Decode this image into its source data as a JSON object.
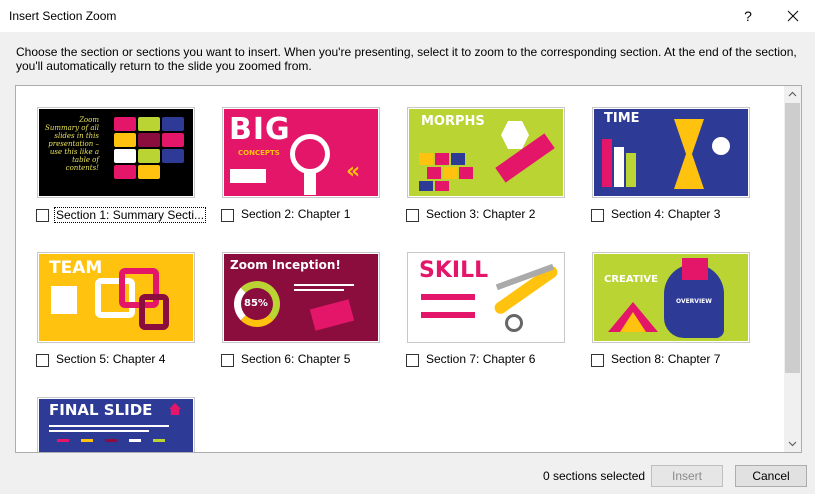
{
  "dialog": {
    "title": "Insert Section Zoom",
    "help_label": "?",
    "instructions": "Choose the section or sections you want to insert. When you're presenting, select it to zoom to the corresponding section. At the end of the section, you'll automatically return to the slide you zoomed from."
  },
  "sections": [
    {
      "label": "Section 1: Summary Secti...",
      "thumb_text": "Zoom Summary of all slides in this presentation – use this like a table of contents!",
      "bg": "#000000",
      "checked": false
    },
    {
      "label": "Section 2: Chapter 1",
      "thumb_text": "BIG",
      "thumb_sub": "CONCEPTS",
      "bg": "#e3166a",
      "checked": false
    },
    {
      "label": "Section 3: Chapter 2",
      "thumb_text": "MORPHS",
      "bg": "#b9d433",
      "checked": false
    },
    {
      "label": "Section 4: Chapter 3",
      "thumb_text": "TIME",
      "bg": "#2d3a96",
      "checked": false
    },
    {
      "label": "Section 5: Chapter 4",
      "thumb_text": "TEAM",
      "bg": "#ffc20e",
      "checked": false
    },
    {
      "label": "Section 6: Chapter 5",
      "thumb_text": "Zoom Inception!",
      "thumb_sub": "85%",
      "bg": "#8a0d3e",
      "checked": false
    },
    {
      "label": "Section 7: Chapter 6",
      "thumb_text": "SKILL",
      "bg": "#ffffff",
      "checked": false
    },
    {
      "label": "Section 8: Chapter 7",
      "thumb_text": "CREATIVE",
      "thumb_sub": "OVERVIEW",
      "bg": "#b9d433",
      "checked": false
    },
    {
      "label": "",
      "thumb_text": "FINAL SLIDE",
      "bg": "#2d3a96",
      "checked": false
    }
  ],
  "footer": {
    "status": "0 sections selected",
    "insert_label": "Insert",
    "cancel_label": "Cancel"
  }
}
